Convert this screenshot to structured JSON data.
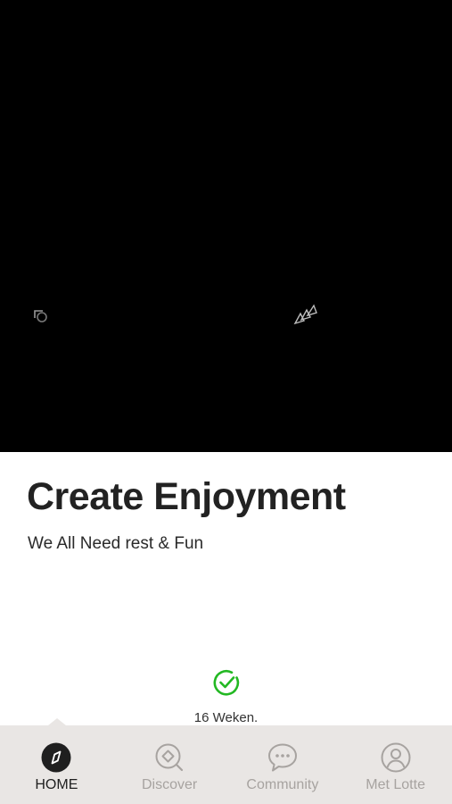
{
  "hero": {
    "left_icon": "rotate-icon",
    "right_icon": "fast-forward-icon"
  },
  "content": {
    "title": "Create Enjoyment",
    "subtitle": "We All Need rest & Fun"
  },
  "status": {
    "icon": "check-circle-icon",
    "text": "16 Weken.",
    "color": "#22b822"
  },
  "nav": {
    "active_index": 0,
    "items": [
      {
        "label": "HOME",
        "icon": "compass-icon"
      },
      {
        "label": "Discover",
        "icon": "discover-icon"
      },
      {
        "label": "Community",
        "icon": "chat-bubble-icon"
      },
      {
        "label": "Met Lotte",
        "icon": "user-icon"
      }
    ]
  },
  "colors": {
    "nav_bg": "#e9e6e4",
    "nav_inactive": "#a7a3a0",
    "nav_active": "#1f1f1f",
    "hero_bg": "#000000"
  }
}
